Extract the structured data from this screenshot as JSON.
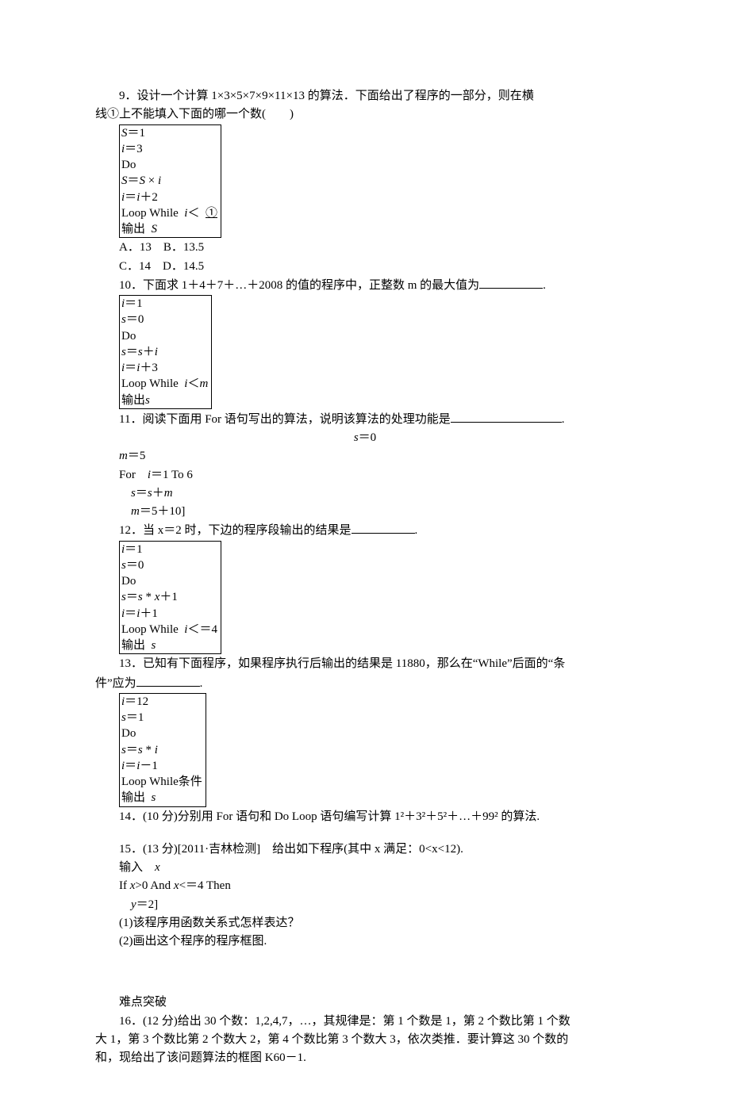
{
  "q9": {
    "stem_a": "9．设计一个计算 1×3×5×7×9×11×13 的算法．下面给出了程序的一部分，则在横",
    "stem_b": "线①上不能填入下面的哪一个数(　　)",
    "code": [
      "S＝1",
      "i＝3",
      "Do",
      "S＝S × i",
      "i＝i＋2",
      "Loop While  i＜  ①",
      "输出  S"
    ],
    "opt1": "A．13　B．13.5",
    "opt2": "C．14　D．14.5"
  },
  "q10": {
    "stem": "10．下面求 1＋4＋7＋…＋2008 的值的程序中，正整数 m 的最大值为",
    "suffix": ".",
    "code": [
      "i＝1",
      "s＝0",
      "Do",
      "s＝s＋i",
      "i＝i＋3",
      "Loop While  i＜m",
      "输出s"
    ]
  },
  "q11": {
    "stem": "11．阅读下面用 For 语句写出的算法，说明该算法的处理功能是",
    "suffix": ".",
    "center": "s＝0",
    "lines": [
      "m＝5",
      "For　i＝1 To 6",
      "　s＝s＋m",
      "　m＝5＋10]"
    ]
  },
  "q12": {
    "stem": "12．当 x＝2 时，下边的程序段输出的结果是",
    "suffix": ".",
    "code": [
      "i＝1",
      "s＝0",
      "Do",
      "s＝s * x＋1",
      "i＝i＋1",
      "Loop While  i＜＝4",
      "输出  s"
    ]
  },
  "q13": {
    "stem_a": "13．已知有下面程序，如果程序执行后输出的结果是 11880，那么在“While”后面的“条",
    "stem_b": "件”应为",
    "suffix": ".",
    "code": [
      "i＝12",
      "s＝1",
      "Do",
      "s＝s * i",
      "i＝i－1",
      "Loop While条件",
      "输出  s"
    ]
  },
  "q14": "14．(10 分)分别用 For 语句和 Do Loop 语句编写计算 1²＋3²＋5²＋…＋99² 的算法.",
  "q15": {
    "stem": "15．(13 分)[2011·吉林检测]　给出如下程序(其中 x 满足：0<x<12).",
    "lines": [
      "输入　x",
      "If x>0 And x<＝4 Then",
      "　y＝2]"
    ],
    "sub1": "(1)该程序用函数关系式怎样表达？",
    "sub2": "(2)画出这个程序的程序框图."
  },
  "hard": "难点突破",
  "q16": {
    "a": "16．(12 分)给出 30 个数：1,2,4,7，…，其规律是：第 1 个数是 1，第 2 个数比第 1 个数",
    "b": "大 1，第 3 个数比第 2 个数大 2，第 4 个数比第 3 个数大 3，依次类推．要计算这 30 个数的",
    "c": "和，现给出了该问题算法的框图 K60－1."
  }
}
